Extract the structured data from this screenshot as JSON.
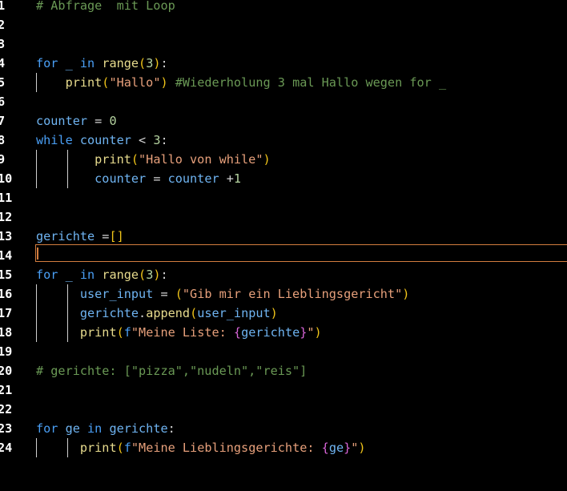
{
  "editor": {
    "line_numbers": [
      "1",
      "2",
      "3",
      "4",
      "5",
      "6",
      "7",
      "8",
      "9",
      "10",
      "11",
      "12",
      "13",
      "14",
      "15",
      "16",
      "17",
      "18",
      "19",
      "20",
      "21",
      "22",
      "23",
      "24"
    ],
    "lines": {
      "l1": [
        {
          "t": "# Abfrage  mit Loop",
          "c": "cm"
        }
      ],
      "l2": [],
      "l3": [],
      "l4": [
        {
          "t": "for",
          "c": "kw"
        },
        {
          "t": " _ ",
          "c": "var"
        },
        {
          "t": "in",
          "c": "kw"
        },
        {
          "t": " ",
          "c": "op"
        },
        {
          "t": "range",
          "c": "fn"
        },
        {
          "t": "(",
          "c": "br1"
        },
        {
          "t": "3",
          "c": "num"
        },
        {
          "t": ")",
          "c": "br1"
        },
        {
          "t": ":",
          "c": "op"
        }
      ],
      "l5": [
        {
          "t": "    ",
          "c": "op"
        },
        {
          "t": "print",
          "c": "fn"
        },
        {
          "t": "(",
          "c": "br1"
        },
        {
          "t": "\"Hallo\"",
          "c": "str"
        },
        {
          "t": ")",
          "c": "br1"
        },
        {
          "t": " #Wiederholung 3 mal Hallo wegen for _",
          "c": "cm"
        }
      ],
      "l6": [],
      "l7": [
        {
          "t": "counter",
          "c": "var"
        },
        {
          "t": " = ",
          "c": "op"
        },
        {
          "t": "0",
          "c": "num"
        }
      ],
      "l8": [
        {
          "t": "while",
          "c": "kw"
        },
        {
          "t": " counter ",
          "c": "var"
        },
        {
          "t": "< ",
          "c": "op"
        },
        {
          "t": "3",
          "c": "num"
        },
        {
          "t": ":",
          "c": "op"
        }
      ],
      "l9": [
        {
          "t": "        ",
          "c": "op"
        },
        {
          "t": "print",
          "c": "fn"
        },
        {
          "t": "(",
          "c": "br1"
        },
        {
          "t": "\"Hallo von while\"",
          "c": "str"
        },
        {
          "t": ")",
          "c": "br1"
        }
      ],
      "l10": [
        {
          "t": "        ",
          "c": "op"
        },
        {
          "t": "counter",
          "c": "var"
        },
        {
          "t": " = ",
          "c": "op"
        },
        {
          "t": "counter",
          "c": "var"
        },
        {
          "t": " +",
          "c": "op"
        },
        {
          "t": "1",
          "c": "num"
        }
      ],
      "l11": [],
      "l12": [],
      "l13": [
        {
          "t": "gerichte",
          "c": "var"
        },
        {
          "t": " =",
          "c": "op"
        },
        {
          "t": "[]",
          "c": "br1"
        }
      ],
      "l14": [],
      "l15": [
        {
          "t": "for",
          "c": "kw"
        },
        {
          "t": " _ ",
          "c": "var"
        },
        {
          "t": "in",
          "c": "kw"
        },
        {
          "t": " ",
          "c": "op"
        },
        {
          "t": "range",
          "c": "fn"
        },
        {
          "t": "(",
          "c": "br1"
        },
        {
          "t": "3",
          "c": "num"
        },
        {
          "t": ")",
          "c": "br1"
        },
        {
          "t": ":",
          "c": "op"
        }
      ],
      "l16": [
        {
          "t": "      ",
          "c": "op"
        },
        {
          "t": "user_input",
          "c": "var"
        },
        {
          "t": " = ",
          "c": "op"
        },
        {
          "t": "(",
          "c": "br1"
        },
        {
          "t": "\"Gib mir ein Lieblingsgericht\"",
          "c": "str"
        },
        {
          "t": ")",
          "c": "br1"
        }
      ],
      "l17": [
        {
          "t": "      ",
          "c": "op"
        },
        {
          "t": "gerichte",
          "c": "var"
        },
        {
          "t": ".",
          "c": "op"
        },
        {
          "t": "append",
          "c": "fn"
        },
        {
          "t": "(",
          "c": "br1"
        },
        {
          "t": "user_input",
          "c": "var"
        },
        {
          "t": ")",
          "c": "br1"
        }
      ],
      "l18": [
        {
          "t": "      ",
          "c": "op"
        },
        {
          "t": "print",
          "c": "fn"
        },
        {
          "t": "(",
          "c": "br1"
        },
        {
          "t": "f",
          "c": "fstr"
        },
        {
          "t": "\"Meine Liste: ",
          "c": "str"
        },
        {
          "t": "{",
          "c": "br2"
        },
        {
          "t": "gerichte",
          "c": "var"
        },
        {
          "t": "}",
          "c": "br2"
        },
        {
          "t": "\"",
          "c": "str"
        },
        {
          "t": ")",
          "c": "br1"
        }
      ],
      "l19": [],
      "l20": [
        {
          "t": "# gerichte: [\"pizza\",\"nudeln\",\"reis\"]",
          "c": "cm"
        }
      ],
      "l21": [],
      "l22": [],
      "l23": [
        {
          "t": "for",
          "c": "kw"
        },
        {
          "t": " ge ",
          "c": "var"
        },
        {
          "t": "in",
          "c": "kw"
        },
        {
          "t": " gerichte",
          "c": "var"
        },
        {
          "t": ":",
          "c": "op"
        }
      ],
      "l24": [
        {
          "t": "      ",
          "c": "op"
        },
        {
          "t": "print",
          "c": "fn"
        },
        {
          "t": "(",
          "c": "br1"
        },
        {
          "t": "f",
          "c": "fstr"
        },
        {
          "t": "\"Meine Lieblingsgerichte: ",
          "c": "str"
        },
        {
          "t": "{",
          "c": "br2"
        },
        {
          "t": "ge",
          "c": "var"
        },
        {
          "t": "}",
          "c": "br2"
        },
        {
          "t": "\"",
          "c": "str"
        },
        {
          "t": ")",
          "c": "br1"
        }
      ]
    },
    "active_line": "14",
    "colors": {
      "background": "#000000",
      "keyword": "#4a9ff5",
      "function": "#e8dc8e",
      "string": "#e7a07b",
      "number": "#b5d3a0",
      "comment": "#6a9955",
      "bracket": "#f0c419",
      "bracket_nested": "#d865d8",
      "variable": "#6fb4f2",
      "current_line_border": "#d37d3f"
    }
  }
}
